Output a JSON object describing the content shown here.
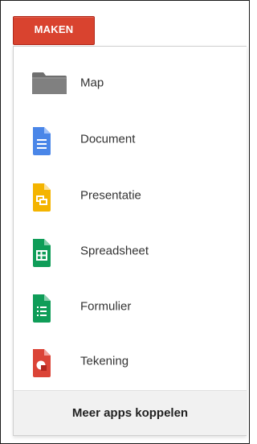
{
  "create_button": {
    "label": "MAKEN"
  },
  "menu": {
    "items": [
      {
        "label": "Map",
        "icon": "folder-icon"
      },
      {
        "label": "Document",
        "icon": "document-icon"
      },
      {
        "label": "Presentatie",
        "icon": "presentation-icon"
      },
      {
        "label": "Spreadsheet",
        "icon": "spreadsheet-icon"
      },
      {
        "label": "Formulier",
        "icon": "form-icon"
      },
      {
        "label": "Tekening",
        "icon": "drawing-icon"
      }
    ],
    "footer_label": "Meer apps koppelen"
  },
  "colors": {
    "button": "#d9432f",
    "folder": "#777777",
    "document": "#4a86e8",
    "presentation": "#f4b400",
    "spreadsheet": "#0f9d58",
    "form": "#0f9d58",
    "drawing": "#db4437"
  }
}
